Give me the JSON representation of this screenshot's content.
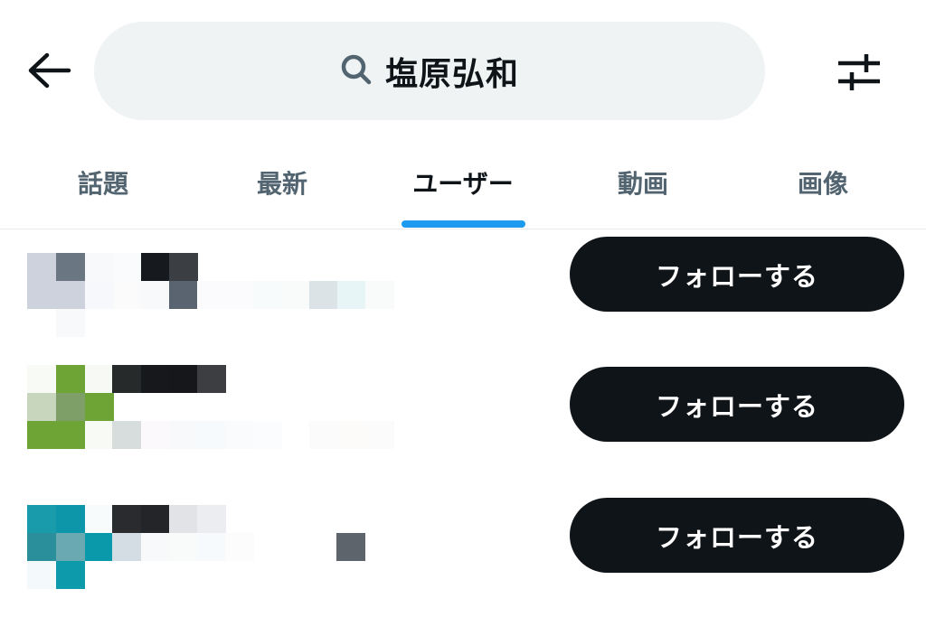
{
  "header": {
    "search": {
      "query": "塩原弘和",
      "icon": "search-icon"
    },
    "back_icon": "arrow-left-icon",
    "filter_icon": "sliders-icon"
  },
  "tabs": [
    {
      "label": "話題",
      "active": false
    },
    {
      "label": "最新",
      "active": false
    },
    {
      "label": "ユーザー",
      "active": true
    },
    {
      "label": "動画",
      "active": false
    },
    {
      "label": "画像",
      "active": false
    }
  ],
  "users": [
    {
      "follow_label": "フォローする"
    },
    {
      "follow_label": "フォローする"
    },
    {
      "follow_label": "フォローする"
    }
  ],
  "colors": {
    "accent": "#1d9bf0",
    "button_bg": "#0f1419",
    "search_bg": "#eff3f4",
    "muted_text": "#536471"
  }
}
